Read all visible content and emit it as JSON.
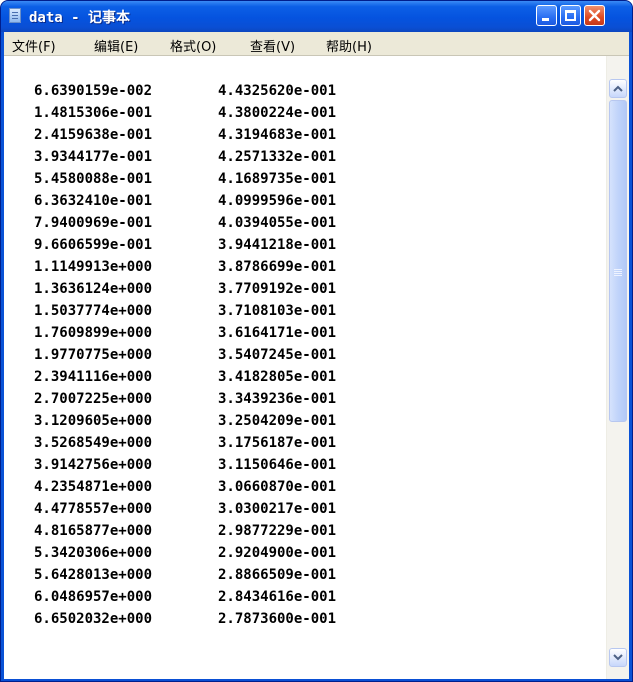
{
  "window": {
    "title": "data - 记事本"
  },
  "menu": {
    "file": "文件(F)",
    "edit": "编辑(E)",
    "format": "格式(O)",
    "view": "查看(V)",
    "help": "帮助(H)"
  },
  "document": {
    "rows": [
      [
        "6.6390159e-002",
        "4.4325620e-001"
      ],
      [
        "1.4815306e-001",
        "4.3800224e-001"
      ],
      [
        "2.4159638e-001",
        "4.3194683e-001"
      ],
      [
        "3.9344177e-001",
        "4.2571332e-001"
      ],
      [
        "5.4580088e-001",
        "4.1689735e-001"
      ],
      [
        "6.3632410e-001",
        "4.0999596e-001"
      ],
      [
        "7.9400969e-001",
        "4.0394055e-001"
      ],
      [
        "9.6606599e-001",
        "3.9441218e-001"
      ],
      [
        "1.1149913e+000",
        "3.8786699e-001"
      ],
      [
        "1.3636124e+000",
        "3.7709192e-001"
      ],
      [
        "1.5037774e+000",
        "3.7108103e-001"
      ],
      [
        "1.7609899e+000",
        "3.6164171e-001"
      ],
      [
        "1.9770775e+000",
        "3.5407245e-001"
      ],
      [
        "2.3941116e+000",
        "3.4182805e-001"
      ],
      [
        "2.7007225e+000",
        "3.3439236e-001"
      ],
      [
        "3.1209605e+000",
        "3.2504209e-001"
      ],
      [
        "3.5268549e+000",
        "3.1756187e-001"
      ],
      [
        "3.9142756e+000",
        "3.1150646e-001"
      ],
      [
        "4.2354871e+000",
        "3.0660870e-001"
      ],
      [
        "4.4778557e+000",
        "3.0300217e-001"
      ],
      [
        "4.8165877e+000",
        "2.9877229e-001"
      ],
      [
        "5.3420306e+000",
        "2.9204900e-001"
      ],
      [
        "5.6428013e+000",
        "2.8866509e-001"
      ],
      [
        "6.0486957e+000",
        "2.8434616e-001"
      ],
      [
        "6.6502032e+000",
        "2.7873600e-001"
      ]
    ]
  },
  "scrollbar": {
    "position": 0
  }
}
